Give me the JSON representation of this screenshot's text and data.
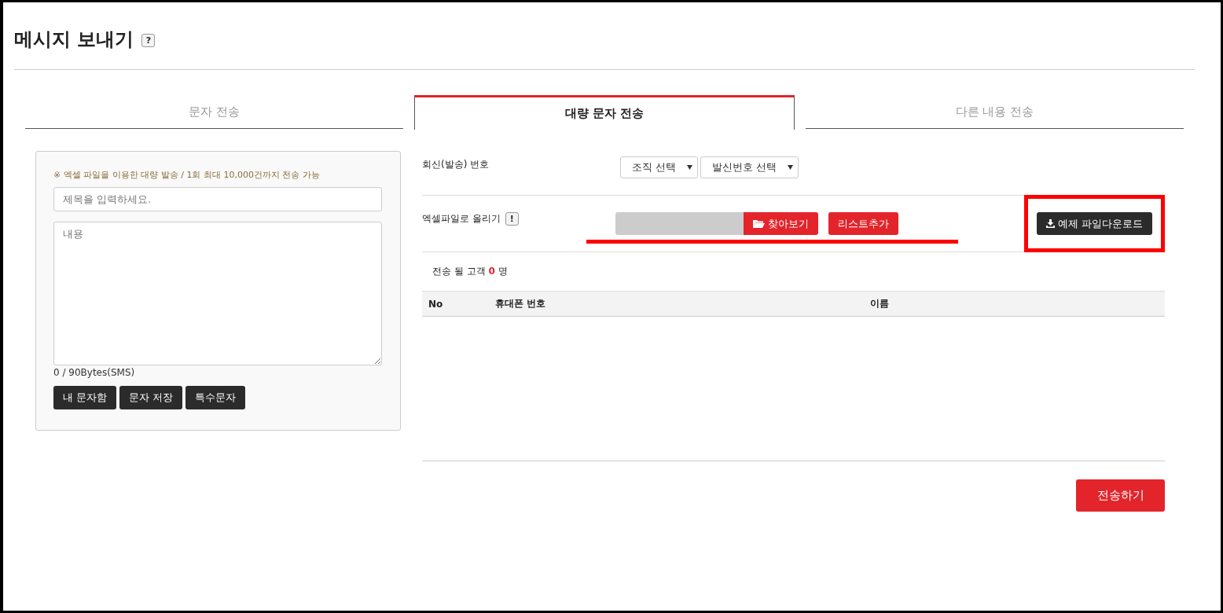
{
  "page": {
    "title": "메시지 보내기",
    "help_icon": "?"
  },
  "tabs": [
    {
      "label": "문자 전송",
      "selected": false
    },
    {
      "label": "대량 문자 전송",
      "selected": true
    },
    {
      "label": "다른 내용 전송",
      "selected": false
    }
  ],
  "compose": {
    "notice": "※ 엑셀 파일을 이용한 대량 발송 / 1회 최대 10,000건까지 전송 가능",
    "subject_placeholder": "제목을 입력하세요.",
    "body_placeholder": "내용",
    "byte_count": "0 / 90Bytes(SMS)",
    "buttons": [
      "내 문자함",
      "문자 저장",
      "특수문자"
    ]
  },
  "reply_number": {
    "label": "회신(발송) 번호",
    "selects": [
      "조직 선택",
      "발신번호 선택"
    ]
  },
  "excel_upload": {
    "label": "엑셀파일로 올리기",
    "info_icon": "!",
    "browse_button": "찾아보기",
    "add_list_button": "리스트추가",
    "sample_download_button": "예제 파일다운로드",
    "underline_marked": true,
    "download_boxed": true
  },
  "recipients": {
    "label_before": "전송 될 고객",
    "count": "0",
    "label_after": "명",
    "columns": [
      "No",
      "휴대폰 번호",
      "이름"
    ]
  },
  "send_button": "전송하기"
}
